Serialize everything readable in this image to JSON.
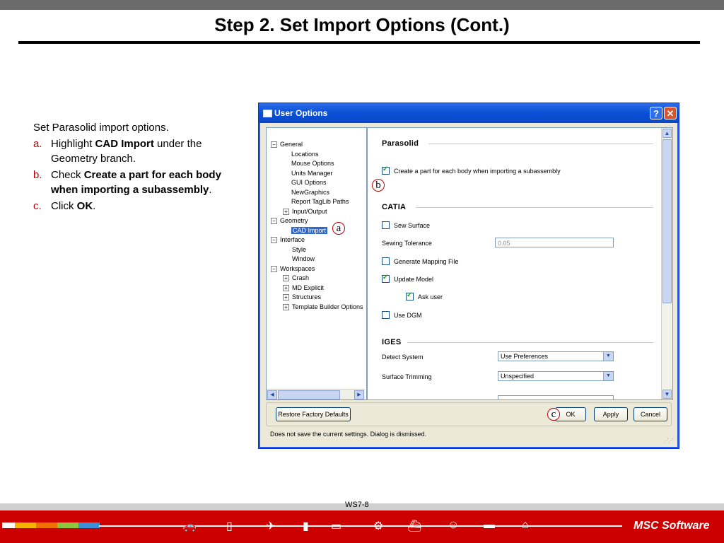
{
  "slide": {
    "title": "Step 2.  Set Import Options (Cont.)",
    "intro": "Set Parasolid import options.",
    "steps": [
      {
        "label": "a.",
        "pre": "Highlight ",
        "bold": "CAD Import",
        "post": " under the Geometry branch."
      },
      {
        "label": "b.",
        "pre": "Check ",
        "bold": "Create a part for each body when importing a subassembly",
        "post": "."
      },
      {
        "label": "c.",
        "pre": "Click ",
        "bold": "OK",
        "post": "."
      }
    ],
    "page_number": "WS7-8",
    "logo": "MSC Software"
  },
  "dialog": {
    "title": "User Options",
    "help_glyph": "?",
    "close_glyph": "✕",
    "tree": [
      {
        "label": "General",
        "expander": "−"
      },
      {
        "label": "Locations"
      },
      {
        "label": "Mouse Options"
      },
      {
        "label": "Units Manager"
      },
      {
        "label": "GUI Options"
      },
      {
        "label": "NewGraphics"
      },
      {
        "label": "Report TagLib Paths"
      },
      {
        "label": "Input/Output",
        "expander": "+"
      },
      {
        "label": "Geometry",
        "expander": "−"
      },
      {
        "label": "CAD Import",
        "selected": true
      },
      {
        "label": "Interface",
        "expander": "−"
      },
      {
        "label": "Style"
      },
      {
        "label": "Window"
      },
      {
        "label": "Workspaces",
        "expander": "−"
      },
      {
        "label": "Crash",
        "expander": "+"
      },
      {
        "label": "MD Explicit",
        "expander": "+"
      },
      {
        "label": "Structures",
        "expander": "+"
      },
      {
        "label": "Template Builder Options",
        "expander": "+"
      }
    ],
    "parasolid": {
      "heading": "Parasolid",
      "create_part_label": "Create a part for each body when importing a subassembly",
      "create_part_checked": true
    },
    "catia": {
      "heading": "CATIA",
      "sew_surface_label": "Sew Surface",
      "sew_surface_checked": false,
      "sewing_tolerance_label": "Sewing Tolerance",
      "sewing_tolerance_value": "0.05",
      "generate_mapping_label": "Generate Mapping File",
      "generate_mapping_checked": false,
      "update_model_label": "Update Model",
      "update_model_checked": true,
      "ask_user_label": "Ask user",
      "ask_user_checked": true,
      "use_dgm_label": "Use DGM",
      "use_dgm_checked": false
    },
    "iges": {
      "heading": "IGES",
      "detect_system_label": "Detect System",
      "detect_system_value": "Use Preferences",
      "surface_trimming_label": "Surface Trimming",
      "surface_trimming_value": "Unspecified"
    },
    "buttons": {
      "restore": "Restore Factory Defaults",
      "ok": "OK",
      "apply": "Apply",
      "cancel": "Cancel"
    },
    "status": "Does not save the current settings. Dialog is dismissed."
  },
  "callouts": {
    "a": "a",
    "b": "b",
    "c": "c"
  },
  "colors": {
    "step_label": "#c00000",
    "title_bar": "#0a4fd6",
    "footer": "#cc0000"
  }
}
